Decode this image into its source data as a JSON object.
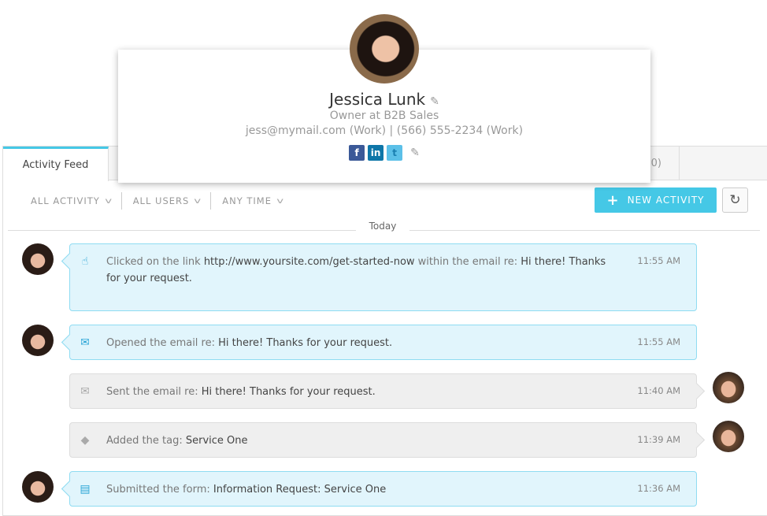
{
  "tabs": [
    {
      "label": "Activity Feed"
    },
    {
      "label": "0)"
    }
  ],
  "filters": [
    "ALL ACTIVITY",
    "ALL USERS",
    "ANY TIME"
  ],
  "new_activity_label": "NEW ACTIVITY",
  "accent": "#45c8e6",
  "date_divider": "Today",
  "contact": {
    "name": "Jessica Lunk",
    "role": "Owner at B2B Sales",
    "email": "jess@mymail.com (Work)",
    "phone": "(566) 555-2234 (Work)",
    "social": [
      "facebook",
      "linkedin",
      "twitter"
    ]
  },
  "activities": [
    {
      "icon": "pointer-hand-icon",
      "text": "Clicked on the link ",
      "h1": "http://www.yoursite.com/get-started-now",
      "mid": " within the email re: ",
      "h2": "Hi there! Thanks for your request.",
      "time": "11:55 AM",
      "side": "contact"
    },
    {
      "icon": "envelope-icon",
      "text": "Opened the email re: ",
      "h1": "Hi there! Thanks for your request.",
      "time": "11:55 AM",
      "side": "contact"
    },
    {
      "icon": "envelope-icon",
      "text": "Sent the email re: ",
      "h1": "Hi there! Thanks for your request.",
      "time": "11:40 AM",
      "side": "user"
    },
    {
      "icon": "tag-icon",
      "text": "Added the tag: ",
      "h1": "Service One",
      "time": "11:39 AM",
      "side": "user"
    },
    {
      "icon": "form-icon",
      "text": "Submitted the form: ",
      "h1": "Information Request: Service One",
      "time": "11:36 AM",
      "side": "contact"
    }
  ]
}
